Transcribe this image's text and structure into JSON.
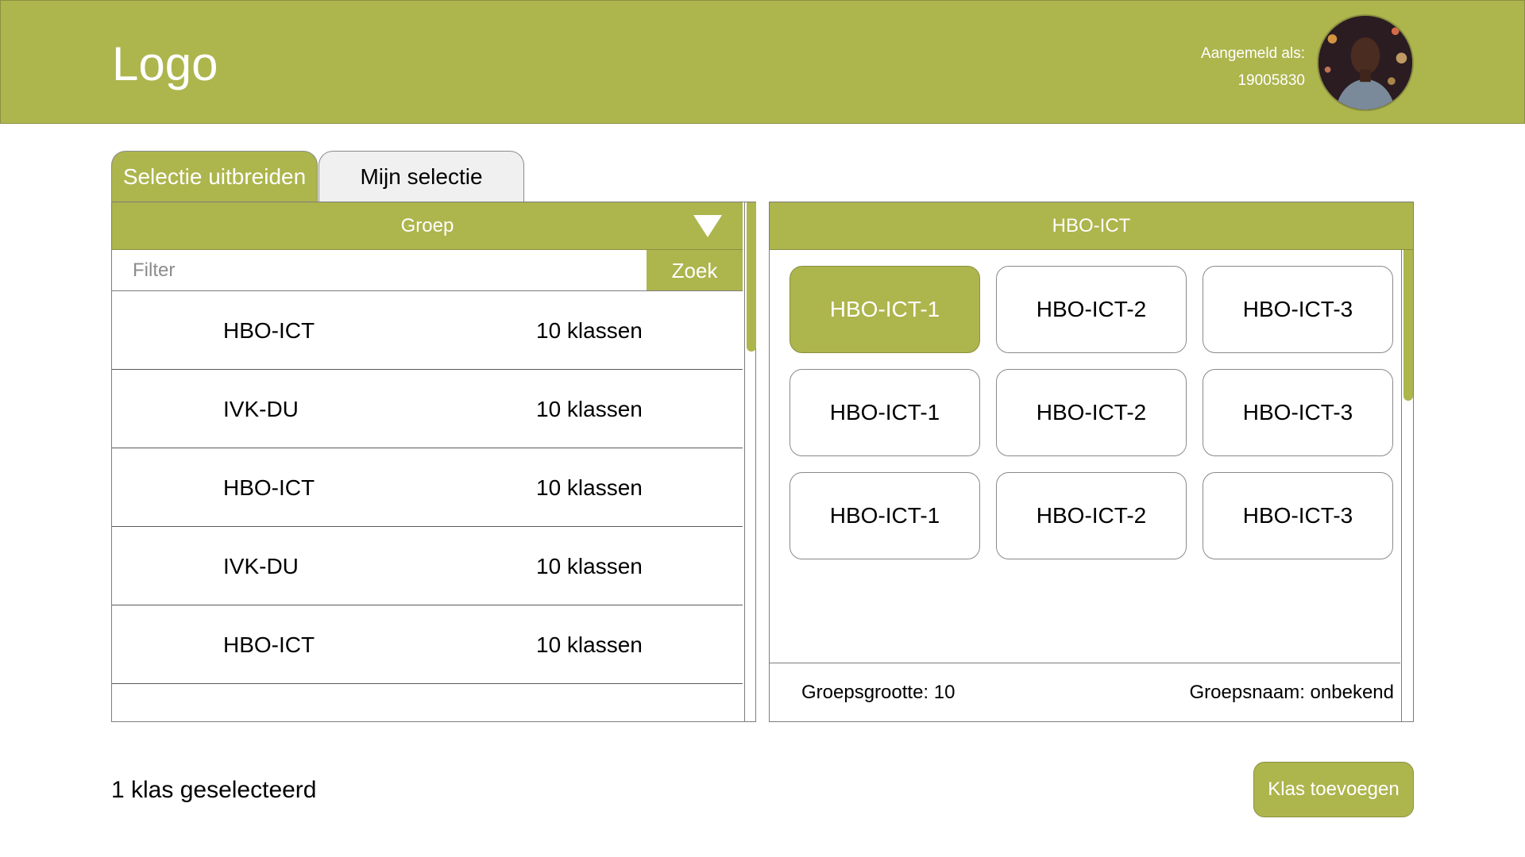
{
  "header": {
    "logo_text": "Logo",
    "logged_in_label": "Aangemeld als:",
    "user_id": "19005830",
    "brand_color": "#adb54d"
  },
  "tabs": [
    {
      "label": "Selectie uitbreiden",
      "active": true
    },
    {
      "label": "Mijn selectie",
      "active": false
    }
  ],
  "left_panel": {
    "dropdown_label": "Groep",
    "filter_placeholder": "Filter",
    "search_label": "Zoek",
    "groups": [
      {
        "name": "HBO-ICT",
        "count": "10 klassen"
      },
      {
        "name": "IVK-DU",
        "count": "10 klassen"
      },
      {
        "name": "HBO-ICT",
        "count": "10 klassen"
      },
      {
        "name": "IVK-DU",
        "count": "10 klassen"
      },
      {
        "name": "HBO-ICT",
        "count": "10 klassen"
      }
    ]
  },
  "right_panel": {
    "title": "HBO-ICT",
    "classes": [
      {
        "label": "HBO-ICT-1",
        "selected": true
      },
      {
        "label": "HBO-ICT-2",
        "selected": false
      },
      {
        "label": "HBO-ICT-3",
        "selected": false
      },
      {
        "label": "HBO-ICT-1",
        "selected": false
      },
      {
        "label": "HBO-ICT-2",
        "selected": false
      },
      {
        "label": "HBO-ICT-3",
        "selected": false
      },
      {
        "label": "HBO-ICT-1",
        "selected": false
      },
      {
        "label": "HBO-ICT-2",
        "selected": false
      },
      {
        "label": "HBO-ICT-3",
        "selected": false
      }
    ],
    "group_size": "Groepsgrootte: 10",
    "group_name": "Groepsnaam: onbekend"
  },
  "footer": {
    "selection_status": "1 klas geselecteerd",
    "add_button_label": "Klas toevoegen"
  }
}
